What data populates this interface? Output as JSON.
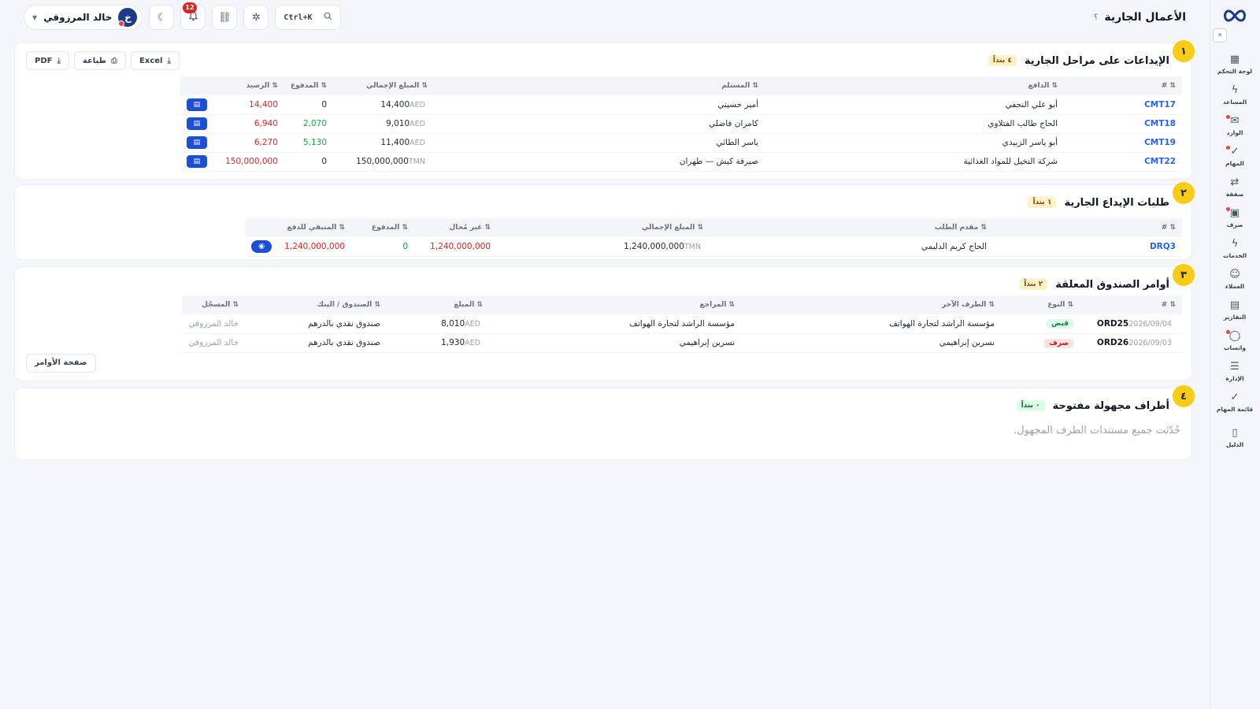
{
  "header": {
    "page_title": "الأعمال الجارية",
    "help": "؟",
    "user_name": "خالد المرزوقي",
    "avatar_initial": "خ",
    "notif_count": "12",
    "search_shortcut": "Ctrl+K"
  },
  "sidebar": {
    "items": [
      {
        "label": "لوحة التحكم",
        "icon": "▦"
      },
      {
        "label": "المساعد",
        "icon": "ϟ"
      },
      {
        "label": "الوارد",
        "icon": "✉"
      },
      {
        "label": "المهام",
        "icon": "✓"
      },
      {
        "label": "صفقة",
        "icon": "⇄"
      },
      {
        "label": "صرف",
        "icon": "▣"
      },
      {
        "label": "الخدمات",
        "icon": "ϟ"
      },
      {
        "label": "العملاء",
        "icon": "☺"
      },
      {
        "label": "التقارير",
        "icon": "▤"
      },
      {
        "label": "واتساب",
        "icon": "◯"
      },
      {
        "label": "الإدارة",
        "icon": "☰"
      },
      {
        "label": "قائمة المهام",
        "icon": "✓"
      },
      {
        "label": "الدليل",
        "icon": "▯"
      }
    ]
  },
  "deposits": {
    "number": "١",
    "title": "الإيداعات على مراحل الجارية",
    "count": "٤ بنداً",
    "exports": {
      "excel": "Excel",
      "print": "طباعة",
      "pdf": "PDF"
    },
    "columns": [
      "#",
      "الدافع",
      "المستلم",
      "المبلغ الإجمالي",
      "المدفوع",
      "الرصيد",
      ""
    ],
    "rows": [
      {
        "code": "CMT17",
        "payer": "أبو علي النجفي",
        "receiver": "أمير حسيني",
        "total": "14,400",
        "cur": "AED",
        "paid": "0",
        "balance": "14,400"
      },
      {
        "code": "CMT18",
        "payer": "الحاج طالب الفتلاوي",
        "receiver": "كامران فاضلي",
        "total": "9,010",
        "cur": "AED",
        "paid": "2,070",
        "balance": "6,940"
      },
      {
        "code": "CMT19",
        "payer": "أبو ياسر الزبيدي",
        "receiver": "ياسر الطائي",
        "total": "11,400",
        "cur": "AED",
        "paid": "5,130",
        "balance": "6,270"
      },
      {
        "code": "CMT22",
        "payer": "شركة النخيل للمواد الغذائية",
        "receiver": "صيرفة كيش — طهران",
        "total": "150,000,000",
        "cur": "TMN",
        "paid": "0",
        "balance": "150,000,000"
      }
    ]
  },
  "deposit_requests": {
    "number": "٢",
    "title": "طلبات الإيداع الجارية",
    "count": "١ بنداً",
    "columns": [
      "#",
      "مقدم الطلب",
      "المبلغ الإجمالي",
      "غير مُحال",
      "المدفوع",
      "المتبقي للدفع",
      ""
    ],
    "rows": [
      {
        "code": "DRQ3",
        "requester": "الحاج كريم الدليمي",
        "total": "1,240,000,000",
        "cur": "TMN",
        "unassigned": "1,240,000,000",
        "paid": "0",
        "remaining": "1,240,000,000"
      }
    ]
  },
  "fund_orders": {
    "number": "٣",
    "title": "أوامر الصندوق المعلقة",
    "count": "٢ بنداً",
    "columns": [
      "#",
      "النوع",
      "الطرف الآخر",
      "المراجع",
      "المبلغ",
      "الصندوق / البنك",
      "المسجّل"
    ],
    "rows": [
      {
        "code": "ORD25",
        "date": "2026/09/04",
        "type": "قبض",
        "type_kind": "in",
        "party": "مؤسسة الراشد لتجارة الهواتف",
        "reviewer": "مؤسسة الراشد لتجارة الهواتف",
        "amount": "8,010",
        "cur": "AED",
        "fund": "صندوق نقدي بالدرهم",
        "registrar": "خالد المرزوقي"
      },
      {
        "code": "ORD26",
        "date": "2026/09/03",
        "type": "صرف",
        "type_kind": "out",
        "party": "نسرين إبراهيمي",
        "reviewer": "نسرين إبراهيمي",
        "amount": "1,930",
        "cur": "AED",
        "fund": "صندوق نقدي بالدرهم",
        "registrar": "خالد المرزوقي"
      }
    ],
    "orders_page_label": "صفحة الأوامر"
  },
  "unknown_parties": {
    "number": "٤",
    "title": "أطراف مجهولة مفتوحة",
    "count": "٠ بنداً",
    "empty_text": "حُدّثت جميع مستندات الطرف المجهول."
  }
}
